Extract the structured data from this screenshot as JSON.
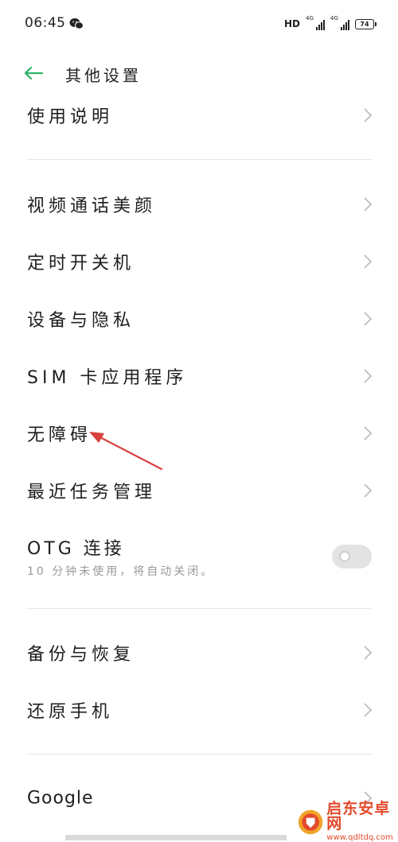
{
  "status_bar": {
    "time": "06:45",
    "hd": "HD",
    "network_1": "4G",
    "network_2": "4G",
    "battery": "74"
  },
  "header": {
    "title": "其他设置"
  },
  "settings": {
    "usage_guide": "使用说明",
    "video_call_beauty": "视频通话美颜",
    "scheduled_power": "定时开关机",
    "device_privacy": "设备与隐私",
    "sim_apps": "SIM 卡应用程序",
    "accessibility": "无障碍",
    "recent_tasks": "最近任务管理",
    "otg": {
      "title": "OTG 连接",
      "subtitle": "10 分钟未使用，将自动关闭。",
      "enabled": false
    },
    "backup_restore": "备份与恢复",
    "reset_phone": "还原手机",
    "google": "Google"
  },
  "watermark": {
    "name": "启东安卓网",
    "url": "www.qdltdq.com"
  },
  "colors": {
    "accent": "#2fb36b",
    "annotation": "#d9413f",
    "divider": "#e6e6e6",
    "chevron": "#bdbdbd"
  }
}
